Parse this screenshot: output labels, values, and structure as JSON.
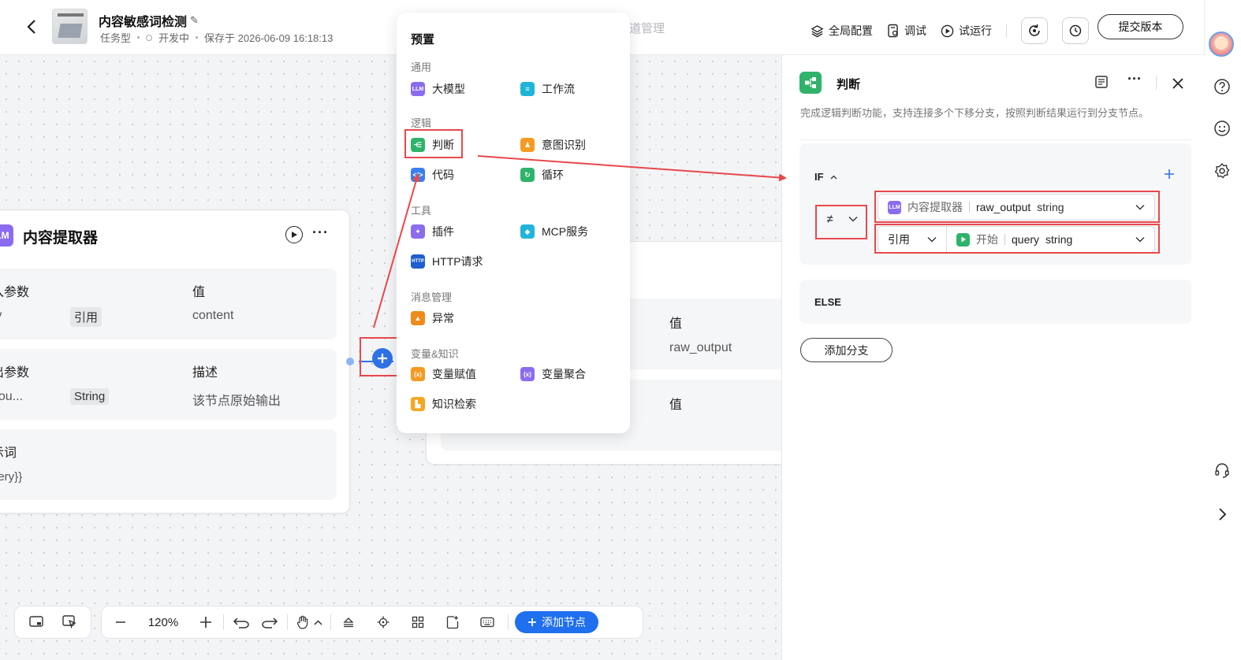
{
  "header": {
    "title": "内容敏感词检测",
    "type": "任务型",
    "status": "开发中",
    "saved": "保存于 2026-06-09 16:18:13",
    "tab_hidden": "道管理",
    "global_config": "全局配置",
    "debug": "调试",
    "trial_run": "试运行",
    "submit": "提交版本"
  },
  "canvas_node_left": {
    "title": "内容提取器",
    "icon_text": "LM",
    "input_header_name": "入参数",
    "input_header_value": "值",
    "input_name": "ry",
    "input_tag": "引用",
    "input_value": "content",
    "output_header_name": "出参数",
    "output_header_desc": "描述",
    "output_name": "_ou...",
    "output_tag": "String",
    "output_desc": "该节点原始输出",
    "prompt_label": "示词",
    "prompt_value": "uery}}"
  },
  "canvas_node_right": {
    "header_value": "值",
    "value": "raw_output",
    "header_value2": "值"
  },
  "menu": {
    "title": "预置",
    "groups": {
      "general": "通用",
      "logic": "逻辑",
      "tools": "工具",
      "message": "消息管理",
      "variable": "变量&知识"
    },
    "items": {
      "llm": "大模型",
      "workflow": "工作流",
      "judge": "判断",
      "intent": "意图识别",
      "code": "代码",
      "loop": "循环",
      "plugin": "插件",
      "mcp": "MCP服务",
      "http": "HTTP请求",
      "exception": "异常",
      "var_assign": "变量赋值",
      "var_aggregate": "变量聚合",
      "knowledge": "知识检索"
    }
  },
  "panel": {
    "title": "判断",
    "description": "完成逻辑判断功能，支持连接多个下移分支，按照判断结果运行到分支节点。",
    "if_label": "IF",
    "operator": "≠",
    "left_node": "内容提取器",
    "left_var": "raw_output",
    "left_type": "string",
    "right_mode": "引用",
    "right_node": "开始",
    "right_var": "query",
    "right_type": "string",
    "else_label": "ELSE",
    "add_branch": "添加分支"
  },
  "toolbar": {
    "zoom": "120%",
    "add_node": "添加节点"
  },
  "colors": {
    "accent": "#1f6fee",
    "highlight": "#e8484b",
    "llm": "#8b6cf0",
    "judge": "#2fb36a"
  }
}
